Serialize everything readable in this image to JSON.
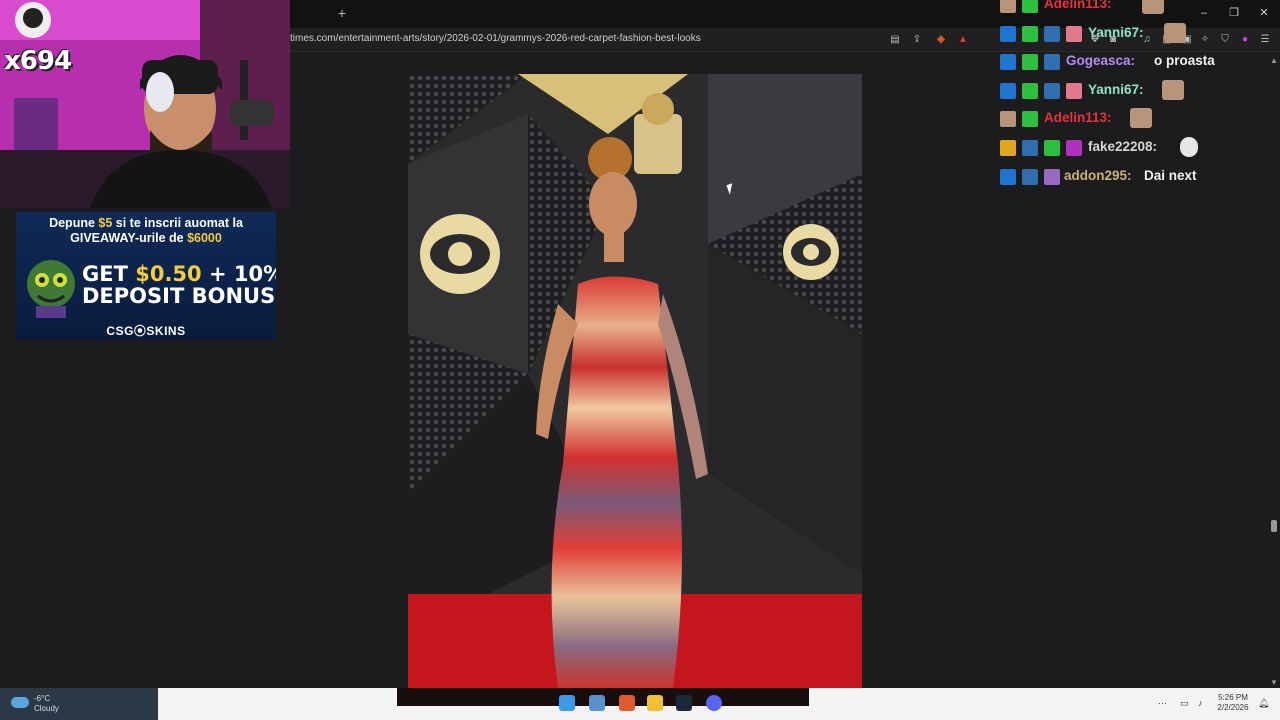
{
  "browser": {
    "new_tab": "+",
    "url": "times.com/entertainment-arts/story/2026-02-01/grammys-2026-red-carpet-fashion-best-looks",
    "window_controls": {
      "minimize": "–",
      "restore": "❐",
      "close": "✕"
    }
  },
  "stream": {
    "viewer_multiplier": "x694"
  },
  "ad": {
    "line1_prefix": "Depune ",
    "line1_amount": "$5",
    "line1_suffix": " si te inscrii auomat la",
    "line2_prefix": "GIVEAWAY-urile de ",
    "line2_amount": "$6000",
    "bonus_prefix": "GET ",
    "bonus_amount": "$0.50",
    "bonus_suffix": " + 10%",
    "bonus_line2": "DEPOSIT BONUS",
    "brand": "CSG⦿SKINS"
  },
  "chat": {
    "messages": [
      {
        "user": "Adelin113:",
        "text": "",
        "color": "#e8323c"
      },
      {
        "user": "Yanni67:",
        "text": "",
        "color": "#8fe3c8"
      },
      {
        "user": "Gogeasca:",
        "text": "o proasta",
        "color": "#b38cf2"
      },
      {
        "user": "Yanni67:",
        "text": "",
        "color": "#8fe3c8"
      },
      {
        "user": "Adelin113:",
        "text": "",
        "color": "#e8323c"
      },
      {
        "user": "fake22208:",
        "text": "",
        "color": "#d7d7d7"
      },
      {
        "user": "addon295:",
        "text": "Dai next",
        "color": "#c9b27a"
      }
    ]
  },
  "taskbar": {
    "weather_temp": "-6°C",
    "weather_desc": "Cloudy",
    "time": "5:26 PM",
    "date": "2/2/2026"
  }
}
